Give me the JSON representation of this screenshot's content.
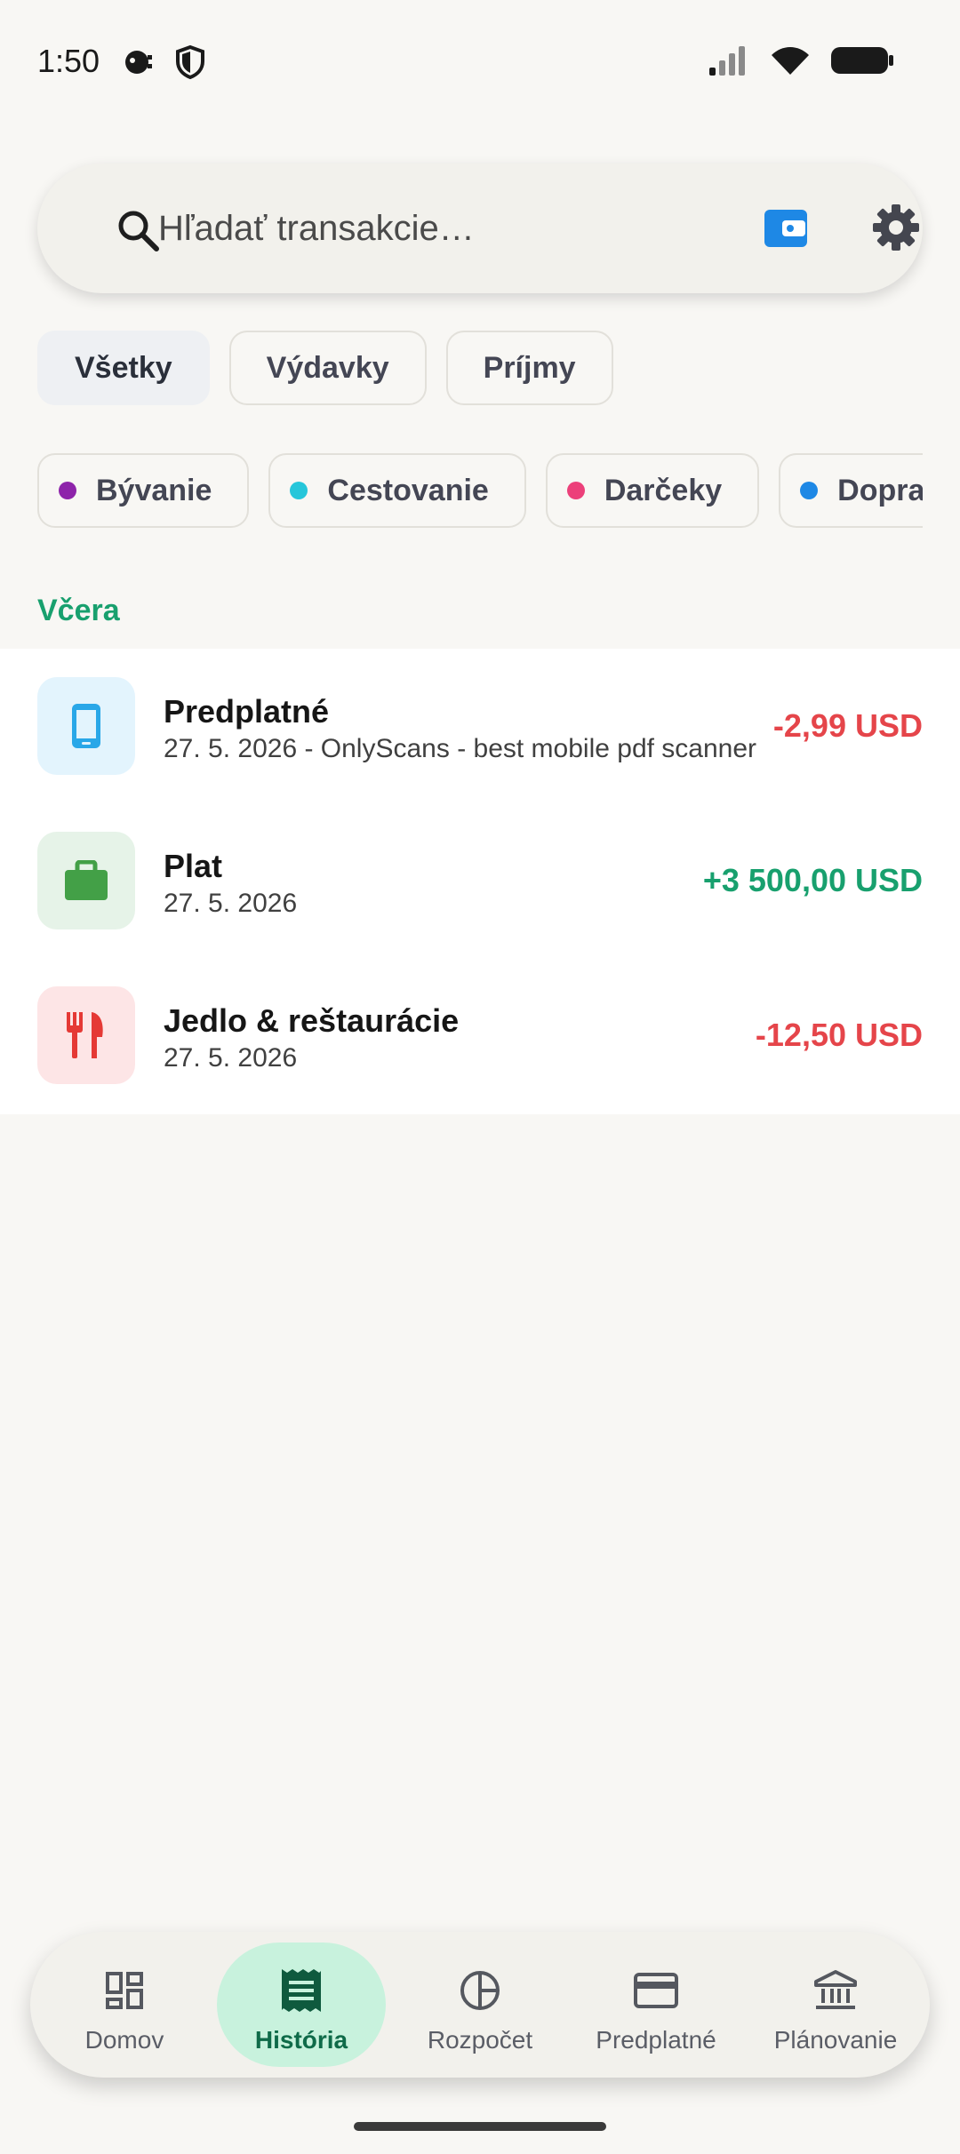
{
  "status_bar": {
    "time": "1:50",
    "left_icons": [
      "notification-icon",
      "shield-icon"
    ],
    "right_icons": [
      "signal-icon",
      "wifi-icon",
      "battery-icon"
    ]
  },
  "search": {
    "placeholder": "Hľadať transakcie…",
    "value": "",
    "icons": [
      "search-icon",
      "wallet-icon",
      "gear-icon"
    ]
  },
  "type_filters": [
    {
      "label": "Všetky",
      "active": true
    },
    {
      "label": "Výdavky",
      "active": false
    },
    {
      "label": "Príjmy",
      "active": false
    }
  ],
  "category_filters": [
    {
      "label": "Bývanie",
      "color": "#8e24aa"
    },
    {
      "label": "Cestovanie",
      "color": "#26c6da"
    },
    {
      "label": "Darčeky",
      "color": "#ec407a"
    },
    {
      "label": "Doprava",
      "color": "#1e88e5"
    }
  ],
  "section": {
    "label": "Včera"
  },
  "transactions": [
    {
      "title": "Predplatné",
      "subtitle": "27. 5. 2026 - OnlyScans - best mobile pdf scanner",
      "amount": "-2,99 USD",
      "type": "expense",
      "icon": "phone-icon",
      "icon_bg": "#e3f4fd",
      "icon_color": "#29a7e8"
    },
    {
      "title": "Plat",
      "subtitle": "27. 5. 2026",
      "amount": "+3 500,00 USD",
      "type": "income",
      "icon": "briefcase-icon",
      "icon_bg": "#e6f3e8",
      "icon_color": "#43a047"
    },
    {
      "title": "Jedlo & reštaurácie",
      "subtitle": "27. 5. 2026",
      "amount": "-12,50 USD",
      "type": "expense",
      "icon": "restaurant-icon",
      "icon_bg": "#fde5e6",
      "icon_color": "#e53935"
    }
  ],
  "bottom_nav": [
    {
      "label": "Domov",
      "icon": "dashboard-icon",
      "active": false
    },
    {
      "label": "História",
      "icon": "receipt-icon",
      "active": true
    },
    {
      "label": "Rozpočet",
      "icon": "pie-chart-icon",
      "active": false
    },
    {
      "label": "Predplatné",
      "icon": "credit-card-icon",
      "active": false
    },
    {
      "label": "Plánovanie",
      "icon": "bank-icon",
      "active": false
    }
  ],
  "colors": {
    "accent": "#18a06e",
    "expense": "#e5454a",
    "wallet": "#1e88e5"
  }
}
